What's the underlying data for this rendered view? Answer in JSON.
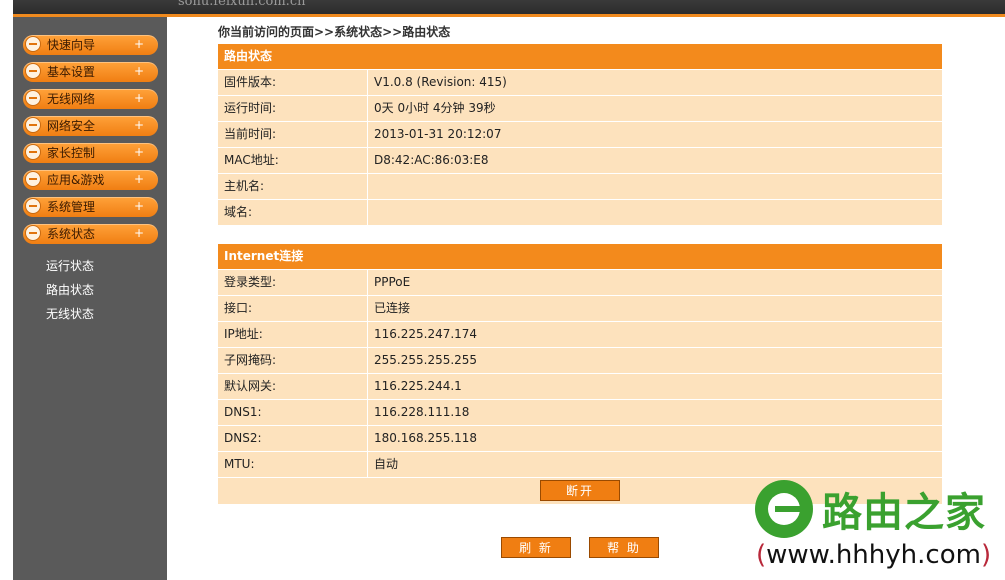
{
  "topbar": {
    "domain": "sohu.feixun.com.cn"
  },
  "sidebar": {
    "menu": [
      {
        "label": "快速向导",
        "plus": "+"
      },
      {
        "label": "基本设置",
        "plus": "+"
      },
      {
        "label": "无线网络",
        "plus": "+"
      },
      {
        "label": "网络安全",
        "plus": "+"
      },
      {
        "label": "家长控制",
        "plus": "+"
      },
      {
        "label": "应用&游戏",
        "plus": "+"
      },
      {
        "label": "系统管理",
        "plus": "+"
      },
      {
        "label": "系统状态",
        "plus": "+"
      }
    ],
    "submenu": [
      "运行状态",
      "路由状态",
      "无线状态"
    ]
  },
  "breadcrumb": "你当前访问的页面>>系统状态>>路由状态",
  "router_status": {
    "title": "路由状态",
    "rows": [
      {
        "k": "固件版本:",
        "v": "V1.0.8 (Revision: 415)"
      },
      {
        "k": "运行时间:",
        "v": "0天  0小时  4分钟  39秒"
      },
      {
        "k": "当前时间:",
        "v": "2013-01-31 20:12:07"
      },
      {
        "k": "MAC地址:",
        "v": "D8:42:AC:86:03:E8"
      },
      {
        "k": "主机名:",
        "v": ""
      },
      {
        "k": "域名:",
        "v": ""
      }
    ]
  },
  "internet": {
    "title": "Internet连接",
    "rows": [
      {
        "k": "登录类型:",
        "v": "PPPoE"
      },
      {
        "k": "接口:",
        "v": "已连接"
      },
      {
        "k": "IP地址:",
        "v": "116.225.247.174"
      },
      {
        "k": "子网掩码:",
        "v": "255.255.255.255"
      },
      {
        "k": "默认网关:",
        "v": "116.225.244.1"
      },
      {
        "k": "DNS1:",
        "v": "116.228.111.18"
      },
      {
        "k": "DNS2:",
        "v": "180.168.255.118"
      },
      {
        "k": "MTU:",
        "v": "自动"
      }
    ],
    "disconnect_label": "断开"
  },
  "buttons": {
    "refresh": "刷 新",
    "help": "帮 助"
  },
  "watermark": {
    "brand": "路由之家",
    "url_open": "(",
    "url": "www.hhhyh.com",
    "url_close": ")"
  },
  "colors": {
    "accent": "#f38a1c",
    "row_bg": "#fde2bd",
    "sidebar": "#5a5a5a",
    "watermark_green": "#3aa12f"
  }
}
